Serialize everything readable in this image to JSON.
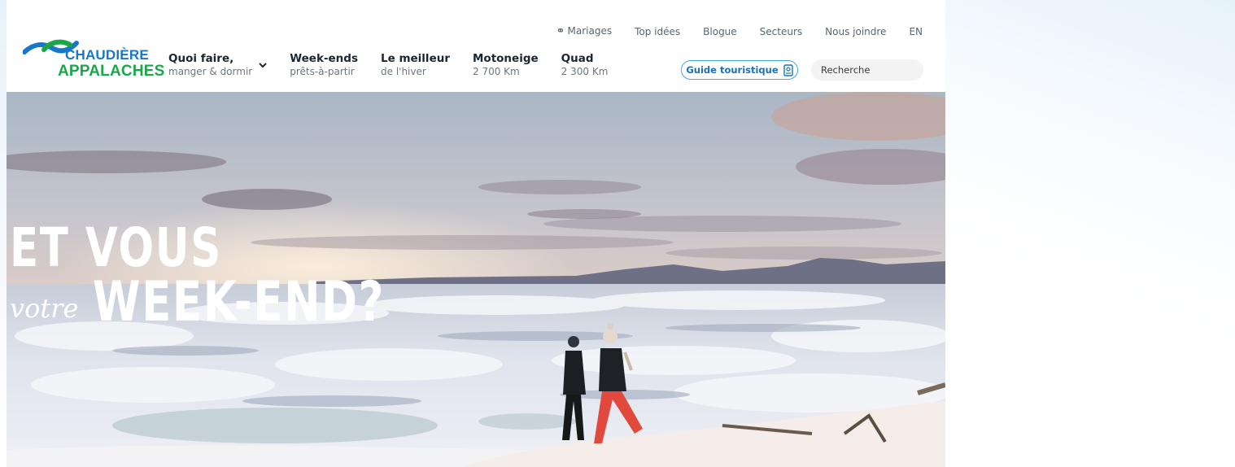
{
  "utility_nav": {
    "items": [
      {
        "label": "Mariages"
      },
      {
        "label": "Top idées"
      },
      {
        "label": "Blogue"
      },
      {
        "label": "Secteurs"
      },
      {
        "label": "Nous joindre"
      },
      {
        "label": "EN"
      }
    ]
  },
  "logo": {
    "line1": "CHAUDIÈRE",
    "line2": "APPALACHES"
  },
  "main_nav": [
    {
      "title": "Quoi faire,",
      "subtitle": "manger & dormir"
    },
    {
      "title": "Week-ends",
      "subtitle": "prêts-à-partir"
    },
    {
      "title": "Le meilleur",
      "subtitle": "de l'hiver"
    },
    {
      "title": "Motoneige",
      "subtitle": "2 700 Km"
    },
    {
      "title": "Quad",
      "subtitle": "2 300 Km"
    }
  ],
  "guide_button": {
    "label": "Guide touristique"
  },
  "search": {
    "placeholder": "Recherche"
  },
  "hero": {
    "line1": "ET VOUS",
    "script": "votre",
    "line2": "WEEK-END?"
  },
  "colors": {
    "brand_blue": "#1976c8",
    "brand_green": "#19a74a",
    "accent_border": "#3fa9df"
  },
  "icons": [
    "rings-icon",
    "chevron-down-icon",
    "brochure-icon",
    "logo-wave-icon"
  ]
}
